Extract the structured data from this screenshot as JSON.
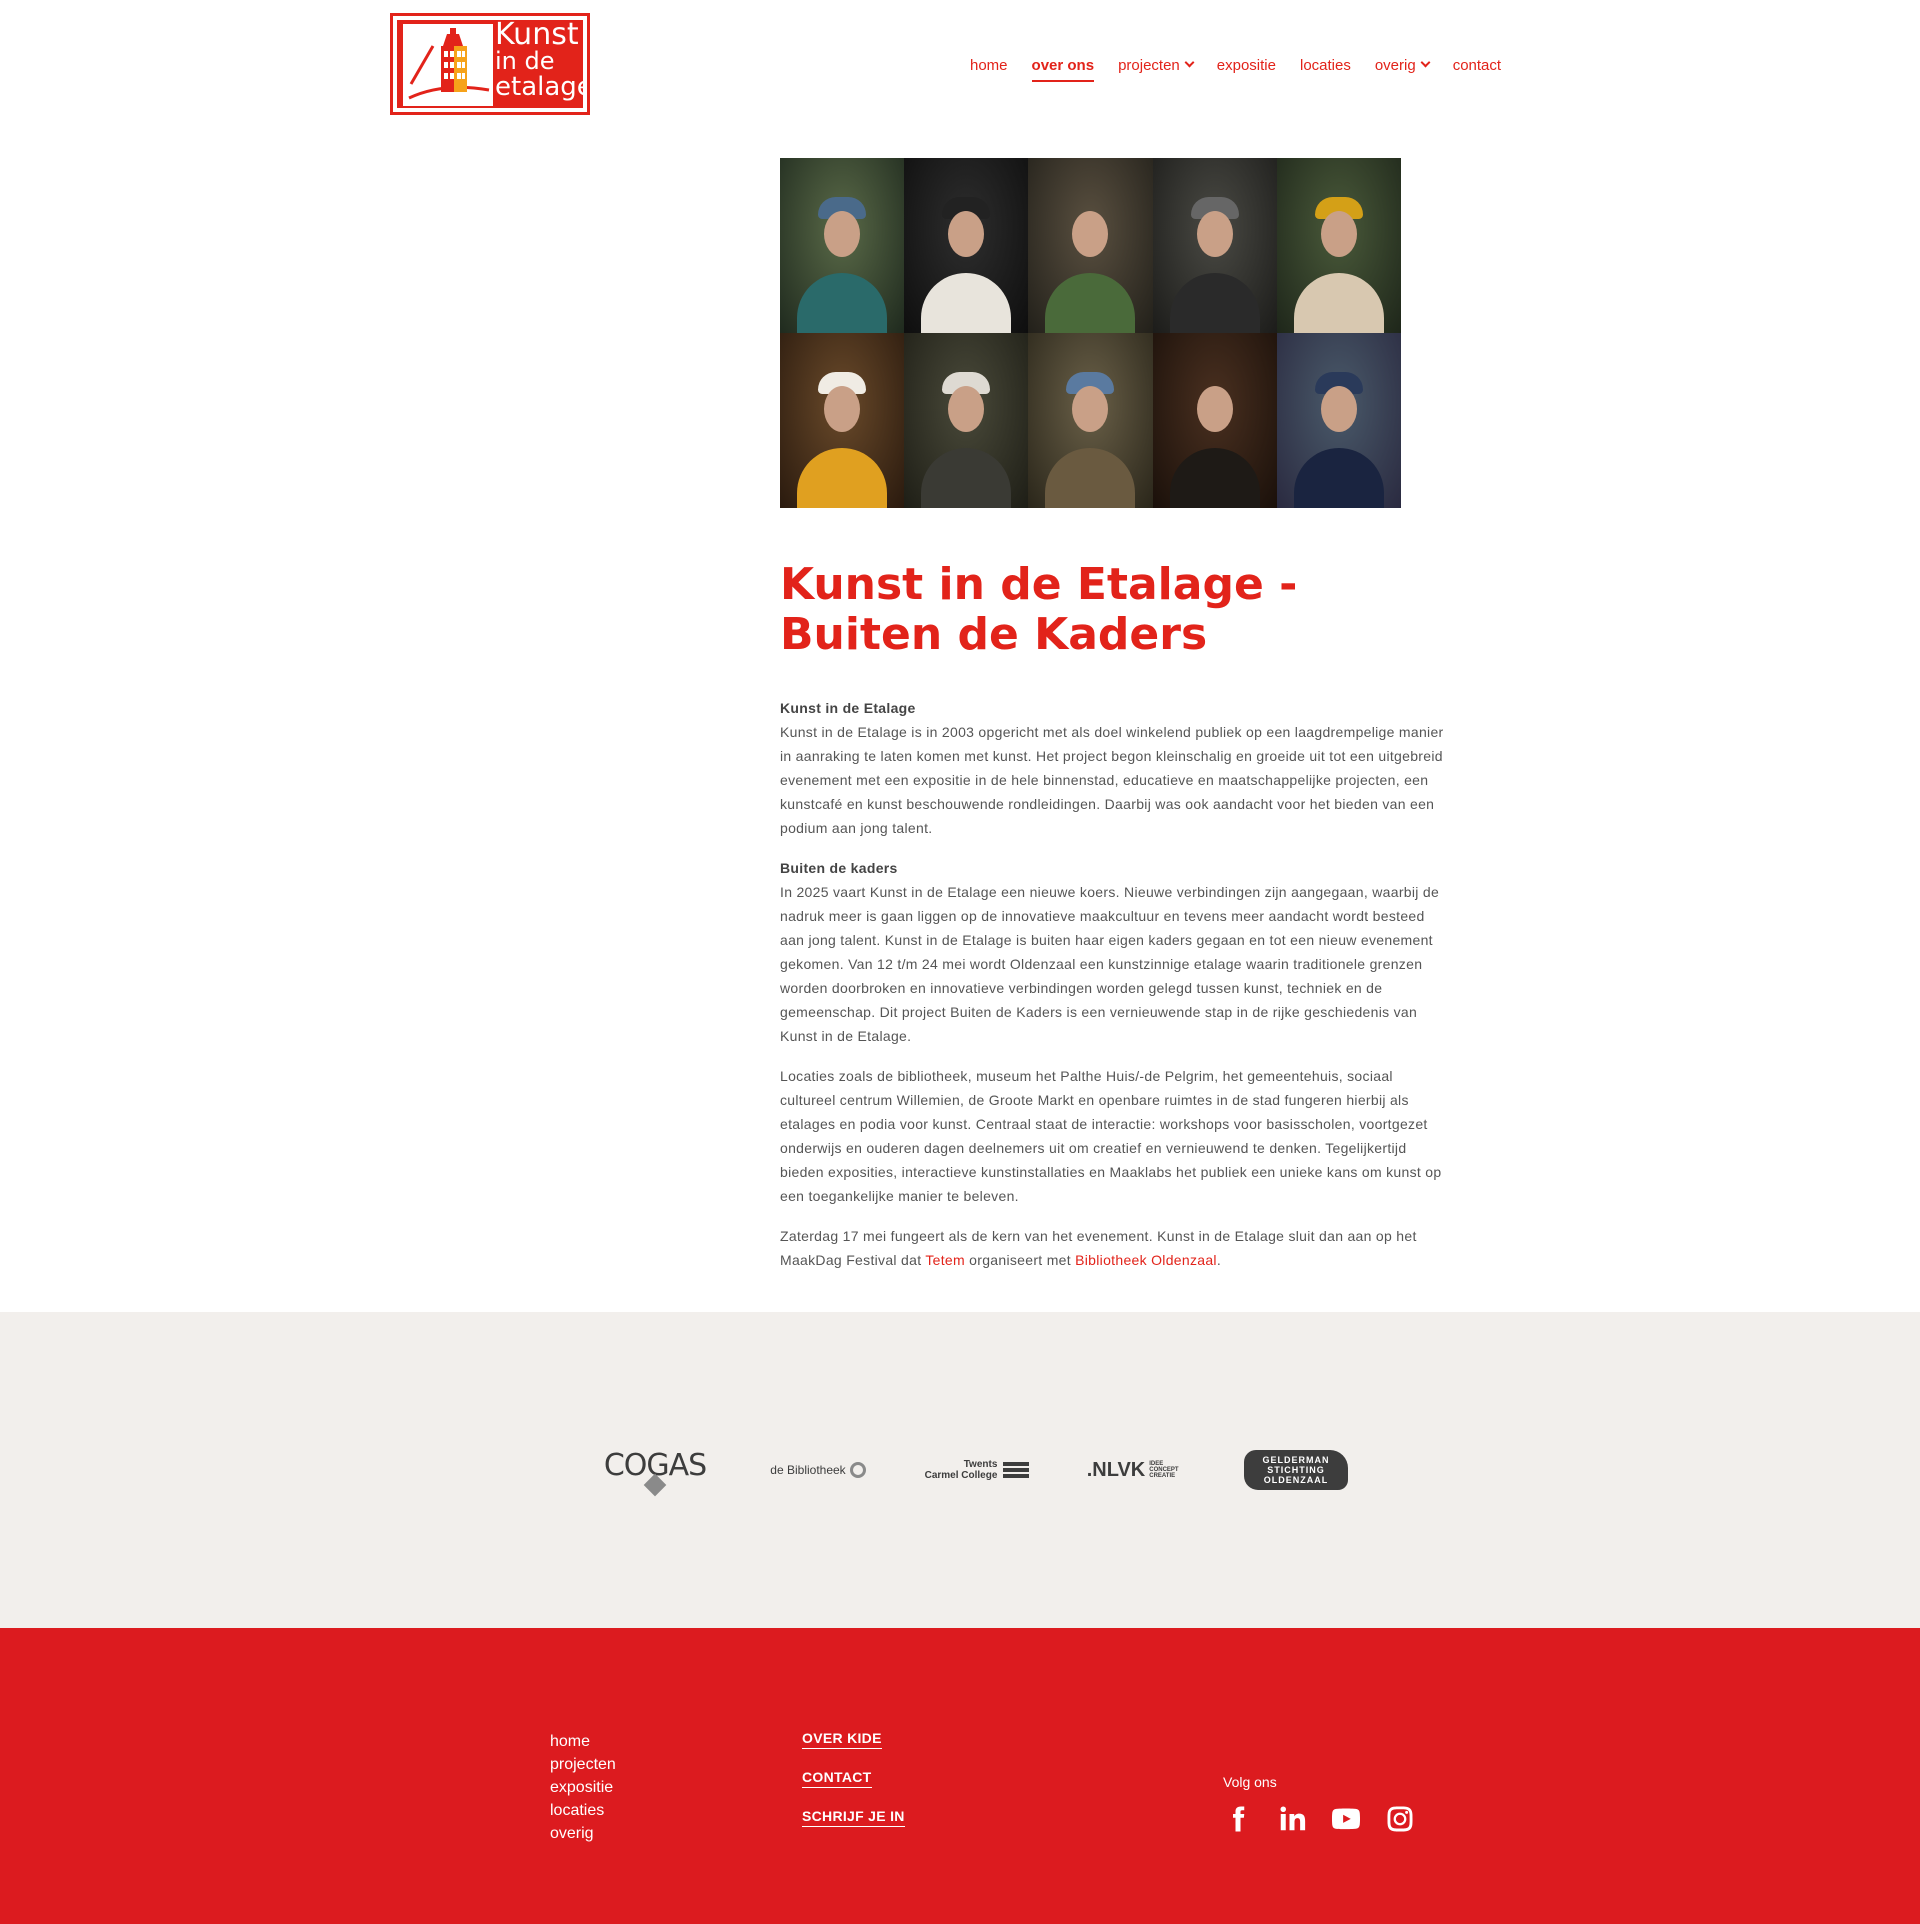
{
  "logo": {
    "line1": "Kunst",
    "line2": "in de",
    "line3": "etalage",
    "brand_color": "#e2231a"
  },
  "nav": {
    "items": [
      {
        "label": "home",
        "active": false,
        "dropdown": false
      },
      {
        "label": "over ons",
        "active": true,
        "dropdown": false
      },
      {
        "label": "projecten",
        "active": false,
        "dropdown": true
      },
      {
        "label": "expositie",
        "active": false,
        "dropdown": false
      },
      {
        "label": "locaties",
        "active": false,
        "dropdown": false
      },
      {
        "label": "overig",
        "active": false,
        "dropdown": true
      },
      {
        "label": "contact",
        "active": false,
        "dropdown": false
      }
    ]
  },
  "main": {
    "title": "Kunst in de Etalage - Buiten de Kaders",
    "section1_heading": "Kunst in de Etalage",
    "section1_text": "Kunst in de Etalage is in 2003 opgericht met als doel winkelend publiek op een laagdrempelige manier in aanraking te laten komen met kunst. Het project begon kleinschalig en groeide uit tot een uitgebreid evenement met een expositie in de hele binnenstad, educatieve en maatschappelijke projecten, een kunstcafé en kunst beschouwende rondleidingen. Daarbij was ook aandacht voor het bieden van een podium aan jong talent.",
    "section2_heading": "Buiten de kaders",
    "section2_text": "In 2025 vaart Kunst in de Etalage een nieuwe koers. Nieuwe verbindingen zijn aangegaan, waarbij de nadruk meer is gaan liggen op de innovatieve maakcultuur en tevens meer aandacht wordt besteed aan jong talent. Kunst in de Etalage is buiten haar eigen kaders gegaan en tot een nieuw evenement gekomen. Van 12 t/m 24 mei wordt Oldenzaal een kunstzinnige etalage waarin traditionele grenzen worden doorbroken en innovatieve verbindingen worden gelegd tussen kunst, techniek en de gemeenschap. Dit project Buiten de Kaders is een vernieuwende stap in de rijke geschiedenis van Kunst in de Etalage.",
    "section3_text": "Locaties zoals de bibliotheek, museum het Palthe Huis/-de Pelgrim, het gemeentehuis, sociaal cultureel centrum Willemien, de Groote Markt en openbare ruimtes in de stad fungeren hierbij als etalages en podia voor kunst. Centraal staat de interactie: workshops voor basisscholen, voortgezet onderwijs en ouderen dagen deelnemers uit om creatief en vernieuwend te denken. Tegelijkertijd bieden exposities, interactieve kunstinstallaties en Maaklabs het publiek een unieke kans om kunst op een toegankelijke manier te beleven.",
    "section4_text_a": "Zaterdag 17 mei fungeert als de kern van het evenement. Kunst in de Etalage sluit dan aan op het MaakDag Festival dat ",
    "section4_link1": "Tetem",
    "section4_text_b": " organiseert met ",
    "section4_link2": "Bibliotheek Oldenzaal",
    "section4_text_c": "."
  },
  "sponsors": {
    "cogas": "COGAS",
    "bibliotheek": "de Bibliotheek",
    "twents_line1": "Twents",
    "twents_line2": "Carmel College",
    "nlvk": ".NLVK",
    "nlvk_sub": "IDEE CONCEPT CREATIE",
    "gelderman_line1": "GELDERMAN",
    "gelderman_line2": "STICHTING",
    "gelderman_line3": "OLDENZAAL"
  },
  "footer": {
    "menu": [
      "home",
      "projecten",
      "expositie",
      "locaties",
      "overig"
    ],
    "links": [
      "OVER KIDE",
      "CONTACT",
      "SCHRIJF JE IN"
    ],
    "follow_label": "Volg ons",
    "social_icons": [
      "facebook-icon",
      "linkedin-icon",
      "youtube-icon",
      "instagram-icon"
    ],
    "background_color": "#dc1b1f"
  }
}
